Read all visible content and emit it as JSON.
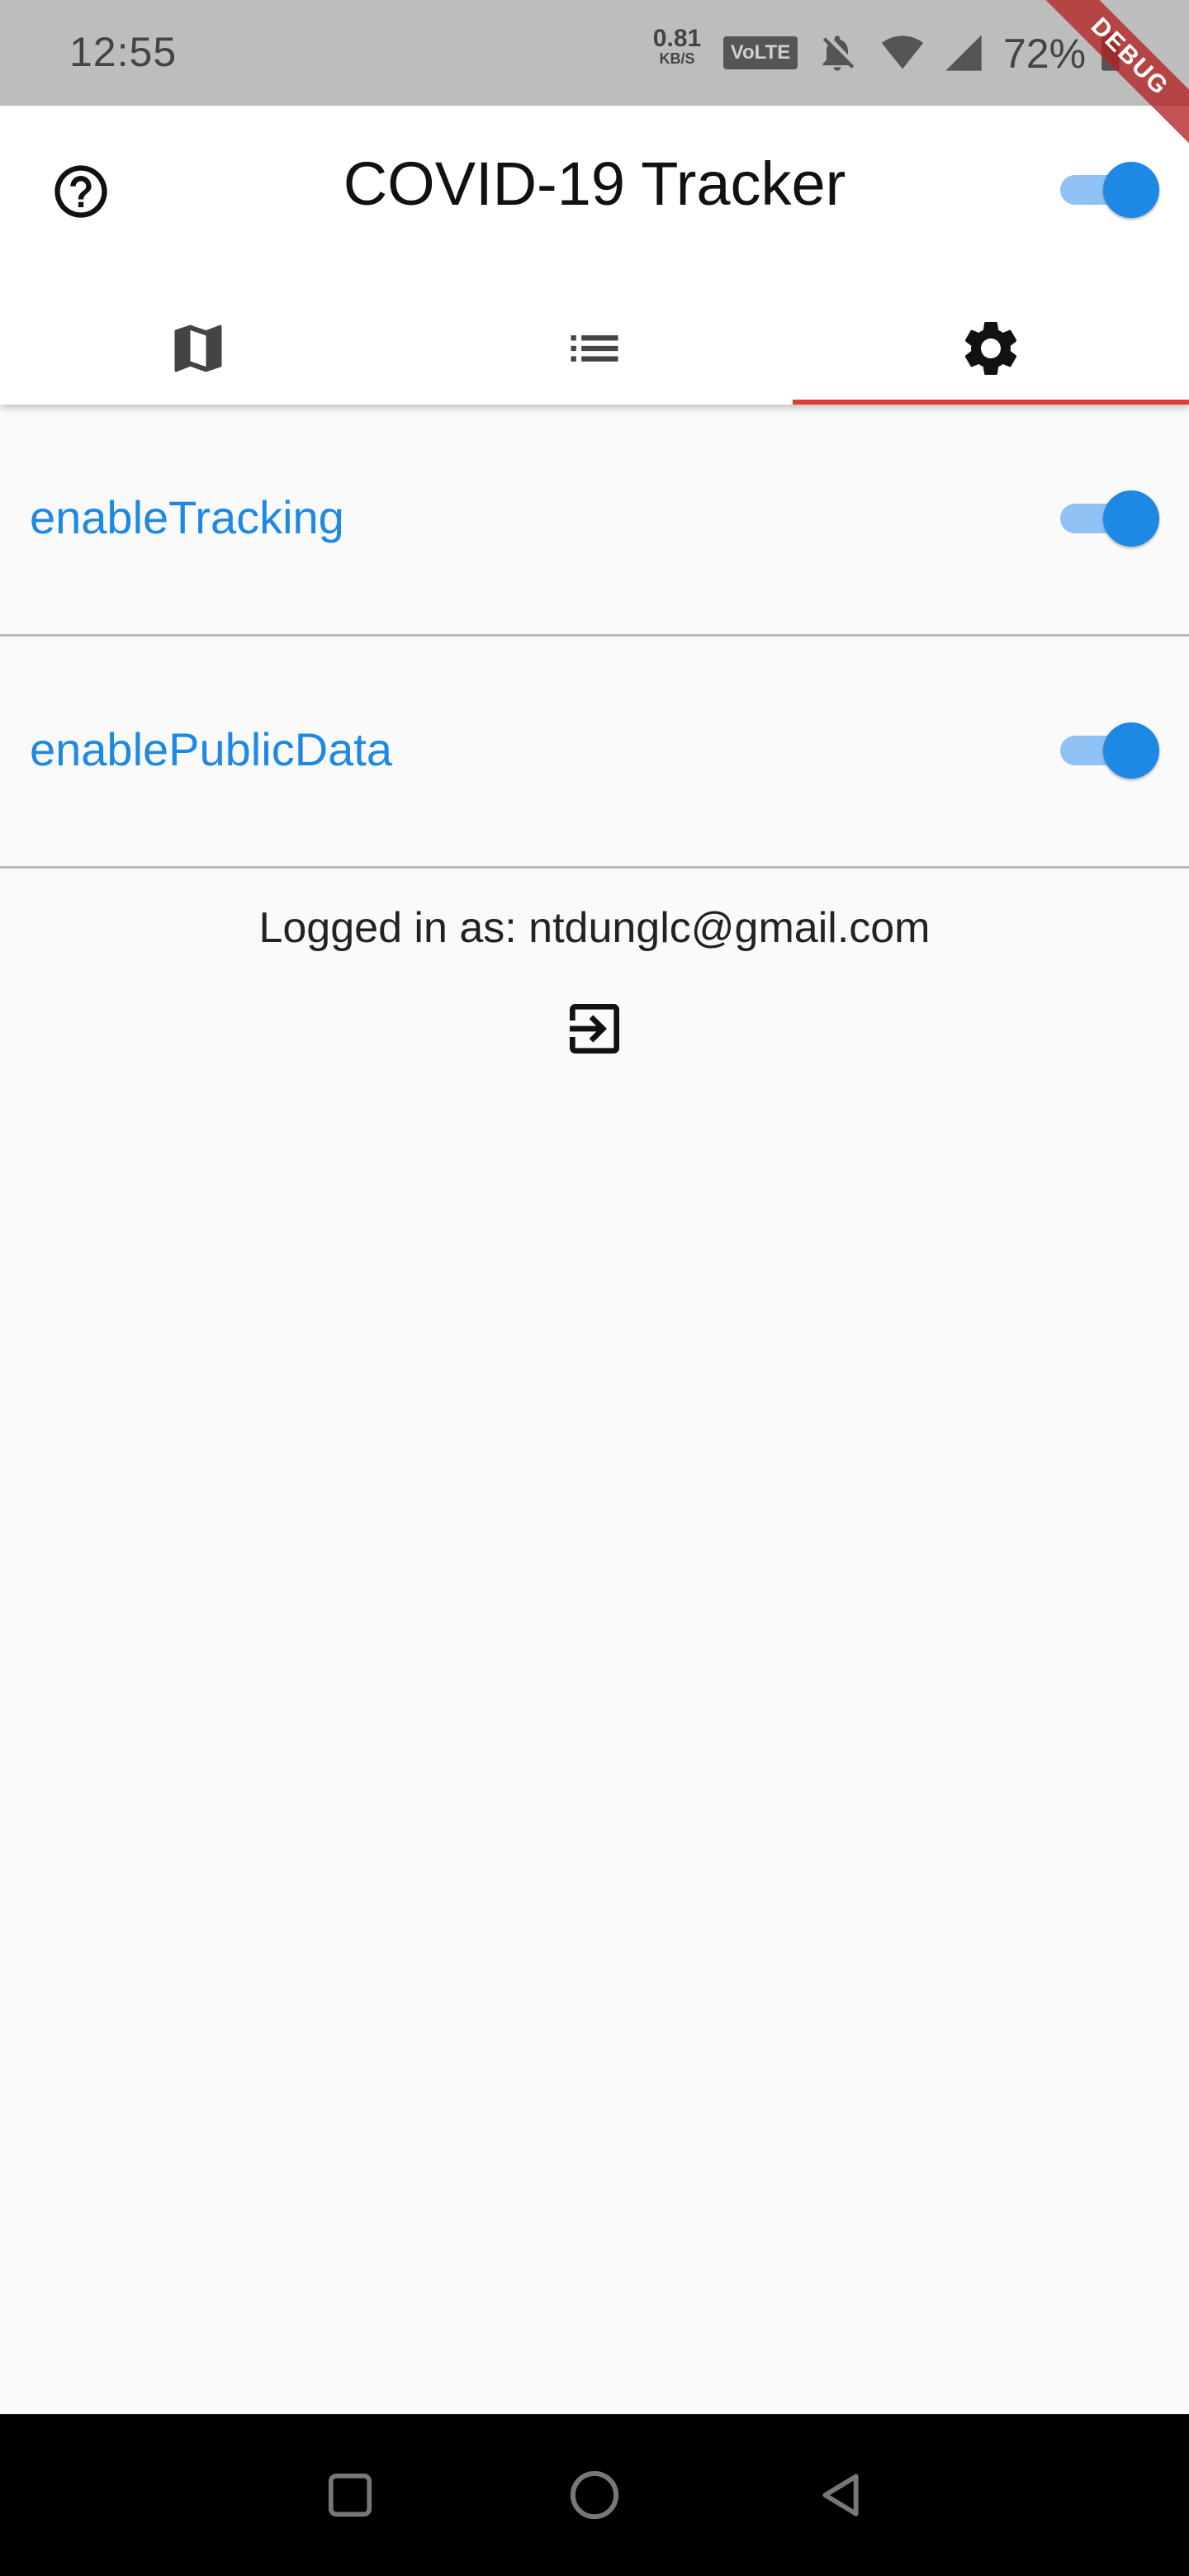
{
  "status_bar": {
    "time": "12:55",
    "net_speed_value": "0.81",
    "net_speed_unit": "KB/S",
    "volte_label": "VoLTE",
    "battery_percent": "72%",
    "icons": [
      "mute-icon",
      "wifi-icon",
      "signal-icon",
      "battery-icon"
    ]
  },
  "debug_banner": "DEBUG",
  "app_bar": {
    "title": "COVID-19 Tracker",
    "help_icon": "help-circle-icon",
    "master_switch_on": true
  },
  "tabs": [
    {
      "icon": "map-icon",
      "active": false
    },
    {
      "icon": "list-icon",
      "active": false
    },
    {
      "icon": "settings-gear-icon",
      "active": true
    }
  ],
  "settings": [
    {
      "label": "enableTracking",
      "enabled": true
    },
    {
      "label": "enablePublicData",
      "enabled": true
    }
  ],
  "account": {
    "logged_in_text": "Logged in as: ntdunglc@gmail.com",
    "logout_icon": "logout-icon"
  },
  "nav_bar": {
    "buttons": [
      "recents-square-icon",
      "home-circle-icon",
      "back-triangle-icon"
    ]
  },
  "colors": {
    "accent": "#1e88e5",
    "switch_track": "#90c2f5",
    "tab_indicator": "#e53935",
    "background": "#fafafa"
  }
}
